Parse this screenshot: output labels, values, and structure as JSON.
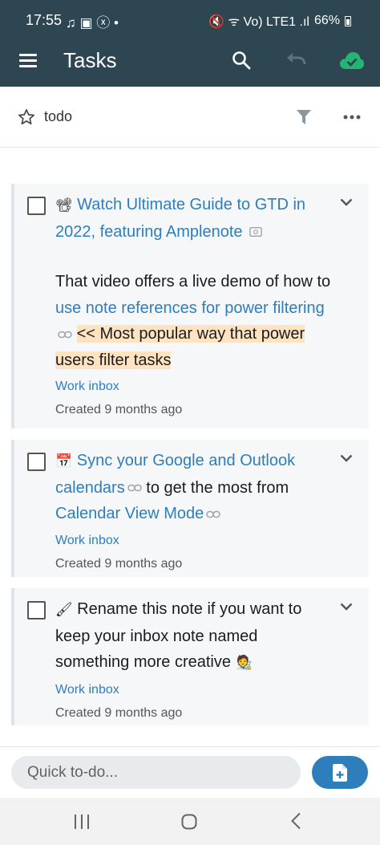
{
  "status_bar": {
    "time": "17:55",
    "left_icons": "♫ ▣ ⓧ •",
    "right_icons": "🔇 ᯤ Vo) LTE1 .ıl",
    "battery": "66%"
  },
  "app_bar": {
    "title": "Tasks",
    "icons": [
      "menu-icon",
      "search-icon",
      "undo-icon",
      "cloud-check-icon"
    ],
    "accent_color": "#2e4652",
    "sync_color": "#22b573"
  },
  "filter_bar": {
    "label": "todo",
    "icons": [
      "star-icon",
      "filter-icon",
      "more-icon"
    ]
  },
  "tasks": [
    {
      "emoji": "📽",
      "title": "Watch Ultimate Guide to GTD in 2022, featuring Amplenote",
      "note_prefix": "That video offers a live demo of how to ",
      "note_link": "use note references for power filtering",
      "note_highlight": "<< Most popular way that power users filter tasks",
      "note_name": "Work inbox",
      "created": "Created 9 months ago"
    },
    {
      "emoji": "📅",
      "title_link": "Sync your Google and Outlook calendars",
      "title_mid": "to get the most from ",
      "title_link2": "Calendar View Mode",
      "note_name": "Work inbox",
      "created": "Created 9 months ago"
    },
    {
      "emoji": "🖌",
      "title": "Rename this note if you want to keep your inbox note named something more creative",
      "emoji_end": "🧑‍🎨",
      "note_name": "Work inbox",
      "created": "Created 9 months ago"
    }
  ],
  "quick_add": {
    "placeholder": "Quick to-do...",
    "button_icon": "add-note-icon",
    "button_color": "#2f7ebc"
  },
  "nav_bar": {
    "icons": [
      "recent-apps-icon",
      "home-icon",
      "back-icon"
    ]
  }
}
